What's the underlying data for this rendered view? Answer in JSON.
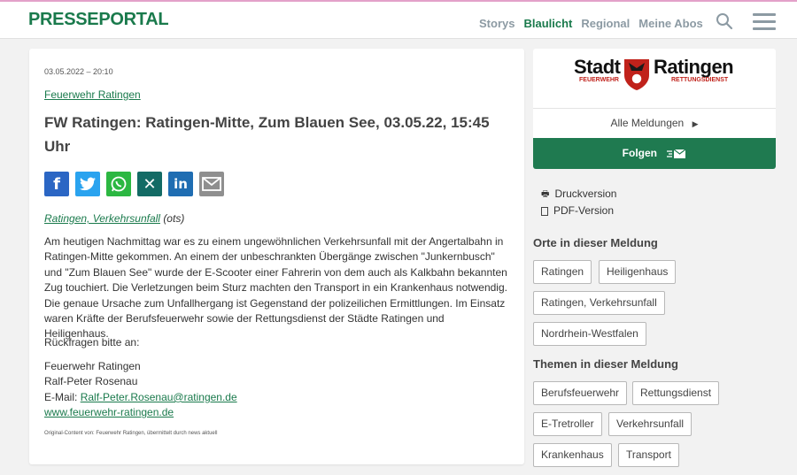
{
  "header": {
    "logo": "PRESSEPORTAL",
    "nav": [
      "Storys",
      "Blaulicht",
      "Regional",
      "Meine Abos"
    ],
    "active_nav": "Blaulicht"
  },
  "article": {
    "date": "03.05.2022 – 20:10",
    "source": "Feuerwehr Ratingen",
    "title": "FW Ratingen: Ratingen-Mitte, Zum Blauen See, 03.05.22, 15:45 Uhr",
    "tags_link": "Ratingen, Verkehrsunfall",
    "tags_suffix": "(ots)",
    "body": "Am heutigen Nachmittag war es zu einem ungewöhnlichen Verkehrsunfall mit der Angertalbahn in Ratingen-Mitte gekommen. An einem der unbeschrankten Übergänge zwischen \"Junkernbusch\" und \"Zum Blauen See\" wurde der E-Scooter einer Fahrerin von dem auch als Kalkbahn bekannten Zug touchiert. Die Verletzungen beim Sturz machten den Transport in ein Krankenhaus notwendig. Die genaue Ursache zum Unfallhergang ist Gegenstand der polizeilichen Ermittlungen. Im Einsatz waren Kräfte der Berufsfeuerwehr sowie der Rettungsdienst der Städte Ratingen und Heiligenhaus.",
    "questions": "Rückfragen bitte an:",
    "contact_org": "Feuerwehr Ratingen",
    "contact_name": "Ralf-Peter Rosenau",
    "email_label": "E-Mail:",
    "email": "Ralf-Peter.Rosenau@ratingen.de",
    "website": "www.feuerwehr-ratingen.de",
    "footnote": "Original-Content von: Feuerwehr Ratingen, übermittelt durch news aktuell"
  },
  "share_icons": [
    "facebook-icon",
    "twitter-icon",
    "whatsapp-icon",
    "xing-icon",
    "linkedin-icon",
    "mail-icon"
  ],
  "sidebar": {
    "org_logo_stadt": "Stadt",
    "org_logo_ratingen": "Ratingen",
    "org_logo_sub1": "FEUERWEHR",
    "org_logo_sub2": "RETTUNGSDIENST",
    "all_messages": "Alle Meldungen",
    "follow": "Folgen",
    "print": "Druckversion",
    "pdf": "PDF-Version",
    "places_title": "Orte in dieser Meldung",
    "places": [
      "Ratingen",
      "Heiligenhaus",
      "Ratingen, Verkehrsunfall",
      "Nordrhein-Westfalen"
    ],
    "topics_title": "Themen in dieser Meldung",
    "topics": [
      "Berufsfeuerwehr",
      "Rettungsdienst",
      "E-Tretroller",
      "Verkehrsunfall",
      "Krankenhaus",
      "Transport"
    ]
  },
  "colors": {
    "brand_green": "#1a7a4c",
    "follow_bg": "#1f7a50"
  }
}
